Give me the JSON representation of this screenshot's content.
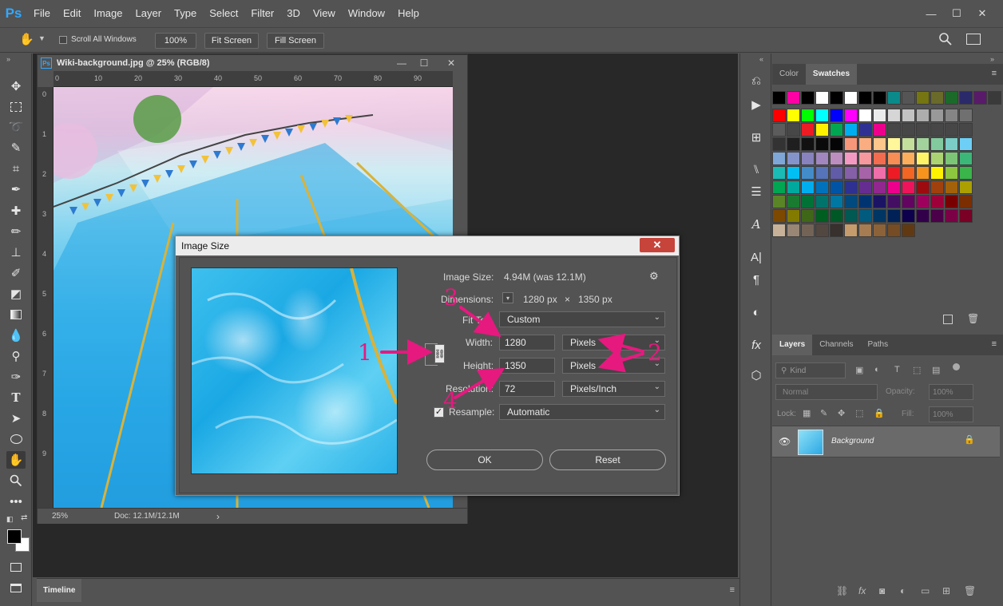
{
  "app": {
    "logo": "Ps",
    "menu": [
      "File",
      "Edit",
      "Image",
      "Layer",
      "Type",
      "Select",
      "Filter",
      "3D",
      "View",
      "Window",
      "Help"
    ],
    "window_controls": {
      "minimize": "—",
      "restore": "☐",
      "close": "✕"
    }
  },
  "options_bar": {
    "scroll_all_windows": "Scroll All Windows",
    "zoom_100": "100%",
    "fit_screen": "Fit Screen",
    "fill_screen": "Fill Screen"
  },
  "document": {
    "badge": "Ps",
    "title": "Wiki-background.jpg @ 25% (RGB/8)",
    "ruler_h_ticks": [
      "0",
      "10",
      "20",
      "30",
      "40",
      "50",
      "60",
      "70",
      "80",
      "90"
    ],
    "ruler_v_ticks": [
      "0",
      "1",
      "2",
      "3",
      "4",
      "5",
      "6",
      "7",
      "8",
      "9"
    ],
    "zoom": "25%",
    "doc_info": "Doc: 12.1M/12.1M",
    "status_arrow": "›"
  },
  "dialog": {
    "title": "Image Size",
    "close": "✕",
    "image_size_label": "Image Size:",
    "image_size_value": "4.94M (was 12.1M)",
    "dimensions_label": "Dimensions:",
    "dimensions_width": "1280 px",
    "dimensions_x": "×",
    "dimensions_height": "1350 px",
    "fit_to_label": "Fit To:",
    "fit_to_value": "Custom",
    "width_label": "Width:",
    "width_value": "1280",
    "width_unit": "Pixels",
    "height_label": "Height:",
    "height_value": "1350",
    "height_unit": "Pixels",
    "resolution_label": "Resolution:",
    "resolution_value": "72",
    "resolution_unit": "Pixels/Inch",
    "resample_label": "Resample:",
    "resample_value": "Automatic",
    "resample_checked": true,
    "ok": "OK",
    "reset": "Reset"
  },
  "annotations": {
    "n1": "1",
    "n2": "2",
    "n3": "3",
    "n4": "4",
    "color": "#e6197f"
  },
  "swatches_panel": {
    "tabs": [
      "Color",
      "Swatches"
    ],
    "active_tab": "Swatches",
    "rows": [
      [
        "#000000",
        "#ff00a5",
        "#000000",
        "#ffffff",
        "#000000",
        "#ffffff",
        "#000000",
        "#000000",
        "#0a8a8a",
        "#555555",
        "#757512",
        "#6a6a2a",
        "#1b6a2a",
        "#2a2a6a",
        "#5a1a6a",
        "#3a3a3a"
      ],
      [
        "#ff0000",
        "#ffff00",
        "#00ff00",
        "#00ffff",
        "#0000ff",
        "#ff00ff",
        "#ffffff",
        "#ebebeb",
        "#d6d6d6",
        "#c2c2c2",
        "#adadad",
        "#999999",
        "#858585",
        "#707070"
      ],
      [
        "#5c5c5c",
        "#474747",
        "#ed1c24",
        "#fff200",
        "#00a651",
        "#00aeef",
        "#2e3192",
        "#ec008c",
        "#474747",
        "#474747",
        "#474747",
        "#474747",
        "#474747",
        "#474747"
      ],
      [
        "#333333",
        "#1f1f1f",
        "#111111",
        "#0a0a0a",
        "#050505",
        "#f7977a",
        "#f9ad81",
        "#fdc68a",
        "#fff79a",
        "#c4df9b",
        "#a3d39c",
        "#82ca9d",
        "#7bcdc8",
        "#6ecff6"
      ],
      [
        "#7ea7d8",
        "#8493ca",
        "#8882be",
        "#a187be",
        "#bc8dbf",
        "#f49ac2",
        "#f6989d",
        "#f26c4f",
        "#f68e55",
        "#fbaf5c",
        "#fff467",
        "#acd372",
        "#7cc576",
        "#3bb878"
      ],
      [
        "#1abbb4",
        "#00bff3",
        "#438cca",
        "#5574b9",
        "#605ca8",
        "#855fa8",
        "#a763a8",
        "#f06ea9",
        "#ed1c24",
        "#f26522",
        "#f7941d",
        "#fff200",
        "#8dc63f",
        "#39b54a"
      ],
      [
        "#00a651",
        "#00a99d",
        "#00aeef",
        "#0072bc",
        "#0054a6",
        "#2e3192",
        "#662d91",
        "#92278f",
        "#ec008c",
        "#ed145b",
        "#9e0b0f",
        "#a0410d",
        "#a36209",
        "#aba000"
      ],
      [
        "#598527",
        "#197b30",
        "#007236",
        "#00746b",
        "#0076a3",
        "#004a80",
        "#003471",
        "#1b1464",
        "#440e62",
        "#630460",
        "#9e005d",
        "#9e0039",
        "#790000",
        "#7b2e00"
      ],
      [
        "#7d4900",
        "#827b00",
        "#406618",
        "#005e20",
        "#005826",
        "#005952",
        "#005b7f",
        "#003663",
        "#002157",
        "#0d004c",
        "#32004b",
        "#4b0049",
        "#7b0046",
        "#7a0026"
      ],
      [
        "#c7b299",
        "#998675",
        "#736357",
        "#534741",
        "#37302d",
        "#c69c6d",
        "#a67c52",
        "#8c6239",
        "#754c24",
        "#603913"
      ]
    ]
  },
  "layers_panel": {
    "tabs": [
      "Layers",
      "Channels",
      "Paths"
    ],
    "active_tab": "Layers",
    "kind": "Kind",
    "blend_mode": "Normal",
    "opacity_label": "Opacity:",
    "opacity_value": "100%",
    "lock_label": "Lock:",
    "fill_label": "Fill:",
    "fill_value": "100%",
    "layer_name": "Background"
  },
  "timeline": {
    "label": "Timeline"
  }
}
